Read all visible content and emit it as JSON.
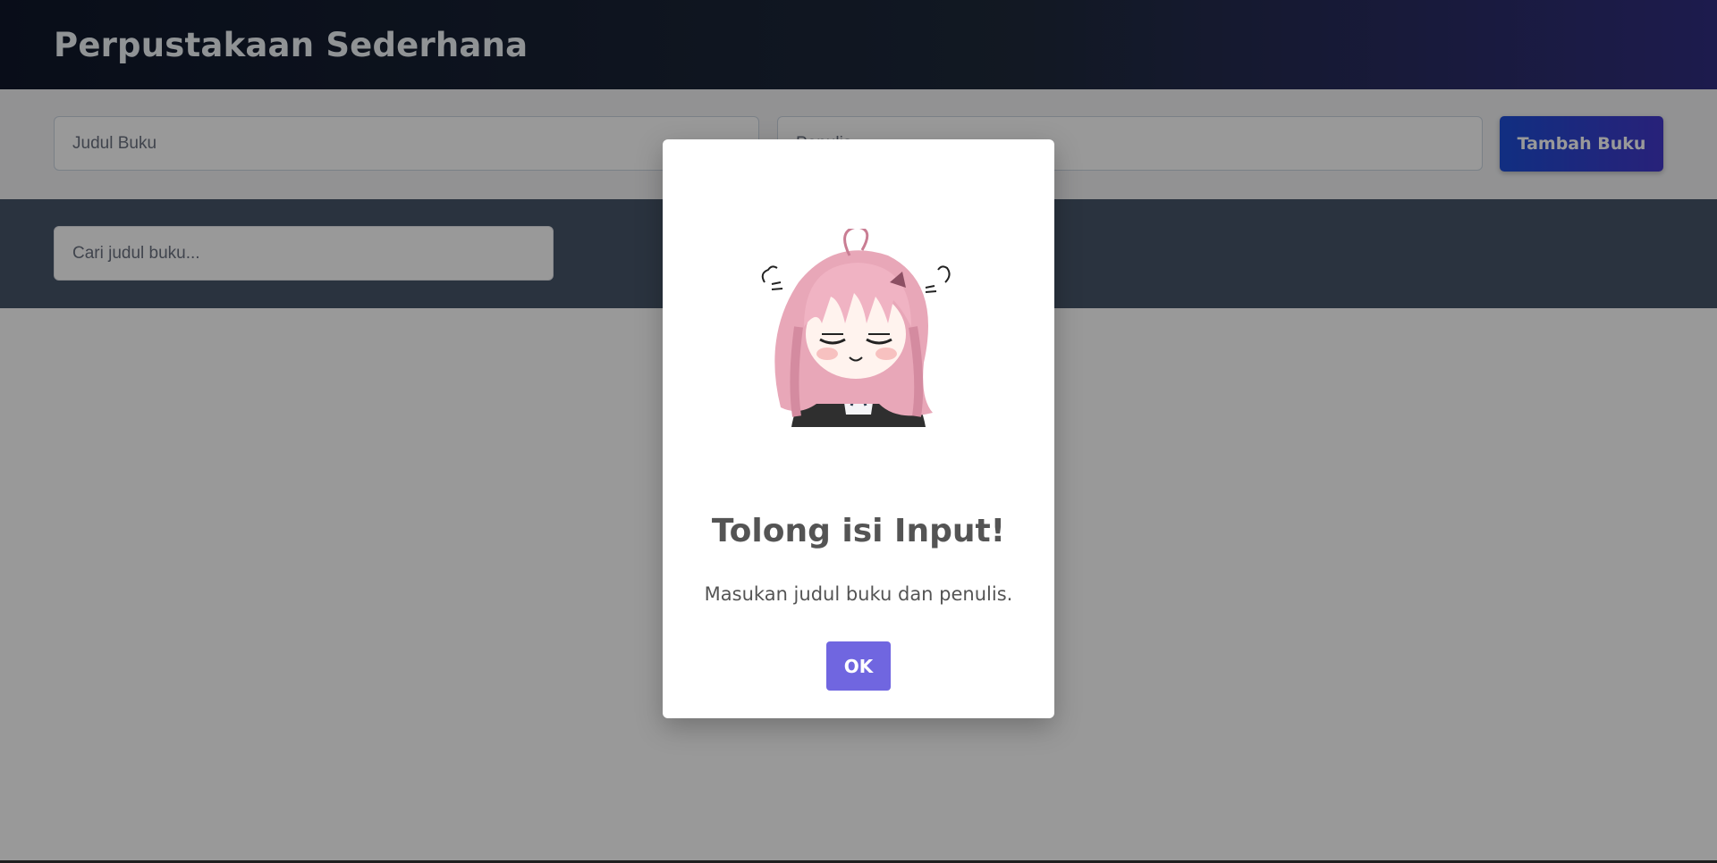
{
  "header": {
    "title": "Perpustakaan Sederhana"
  },
  "add_form": {
    "title_placeholder": "Judul Buku",
    "author_placeholder": "Penulis",
    "title_value": "",
    "author_value": "",
    "submit_label": "Tambah Buku"
  },
  "search": {
    "placeholder": "Cari judul buku...",
    "value": ""
  },
  "alert": {
    "image": "chibi-girl-annoyed-illustration",
    "title": "Tolong isi Input!",
    "text": "Masukan judul buku dan penulis.",
    "confirm_label": "OK"
  },
  "colors": {
    "header_bg": "#0f172a",
    "button_accent": "#1d4ed8",
    "search_band": "#475569",
    "confirm_button": "#7066e0"
  }
}
